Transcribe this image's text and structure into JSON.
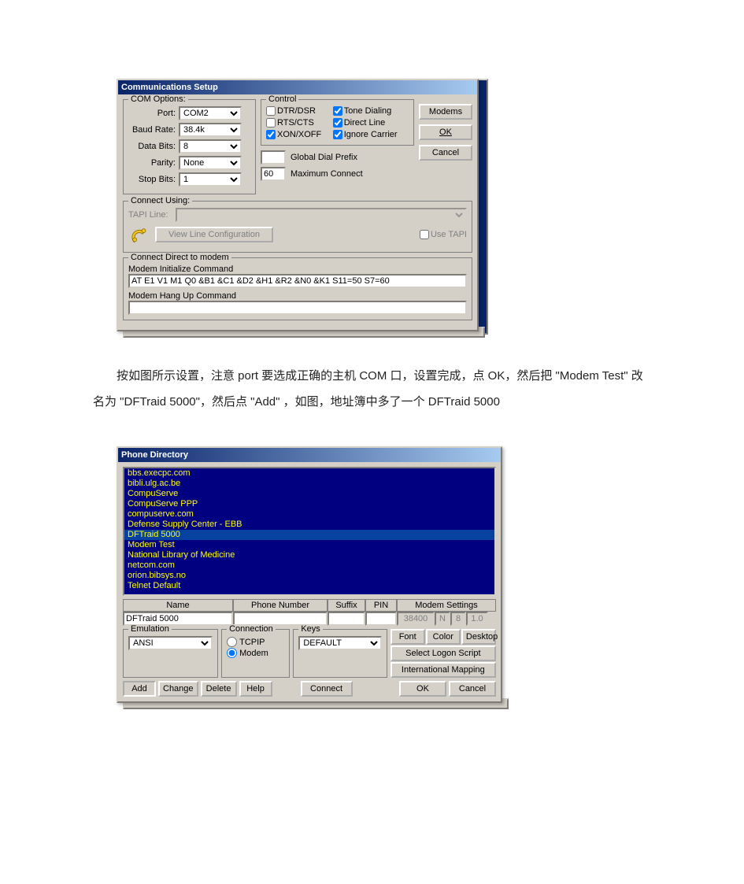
{
  "comm": {
    "title": "Communications Setup",
    "com_options": {
      "legend": "COM Options:",
      "port_label": "Port:",
      "port_value": "COM2",
      "baud_label": "Baud Rate:",
      "baud_value": "38.4k",
      "databits_label": "Data Bits:",
      "databits_value": "8",
      "parity_label": "Parity:",
      "parity_value": "None",
      "stopbits_label": "Stop Bits:",
      "stopbits_value": "1"
    },
    "control": {
      "legend": "Control",
      "dtr": "DTR/DSR",
      "rts": "RTS/CTS",
      "xon": "XON/XOFF",
      "tone": "Tone Dialing",
      "direct": "Direct Line",
      "ignore": "Ignore Carrier",
      "prefix_label": "Global Dial Prefix",
      "prefix_value": "",
      "maxconn_label": "Maximum Connect",
      "maxconn_value": "60"
    },
    "buttons": {
      "modems": "Modems",
      "ok": "OK",
      "cancel": "Cancel"
    },
    "connect_using": {
      "legend": "Connect Using:",
      "tapi_label": "TAPI Line:",
      "view_btn": "View Line Configuration",
      "use_tapi": "Use TAPI"
    },
    "direct_modem": {
      "legend": "Connect Direct to modem",
      "init_label": "Modem Initialize Command",
      "init_value": "AT E1 V1 M1 Q0 &B1 &C1 &D2 &H1 &R2 &N0 &K1 S11=50 S7=60",
      "hangup_label": "Modem Hang Up Command",
      "hangup_value": ""
    }
  },
  "paragraph": "按如图所示设置，注意 port 要选成正确的主机 COM 口，设置完成，点 OK，然后把 \"Modem Test\" 改名为 \"DFTraid 5000\"，然后点 \"Add\" ，如图，地址簿中多了一个 DFTraid 5000",
  "phone": {
    "title": "Phone Directory",
    "items": [
      "bbs.execpc.com",
      "bibli.ulg.ac.be",
      "CompuServe",
      "CompuServe PPP",
      "compuserve.com",
      "Defense Supply Center - EBB",
      "DFTraid 5000",
      "Modem Test",
      "National Library of Medicine",
      "netcom.com",
      "orion.bibsys.no",
      "Telnet Default"
    ],
    "selected_index": 6,
    "headers": {
      "name": "Name",
      "phone": "Phone Number",
      "suffix": "Suffix",
      "pin": "PIN",
      "modemset": "Modem Settings"
    },
    "name_value": "DFTraid 5000",
    "phone_value": "",
    "suffix_value": "",
    "pin_value": "",
    "ro1": "38400",
    "ro2": "N",
    "ro3": "8",
    "ro4": "1.0",
    "emulation": {
      "legend": "Emulation",
      "value": "ANSI"
    },
    "connection": {
      "legend": "Connection",
      "tcpip": "TCPIP",
      "modem": "Modem"
    },
    "keys": {
      "legend": "Keys",
      "value": "DEFAULT"
    },
    "right_buttons": {
      "font": "Font",
      "color": "Color",
      "desktop": "Desktop",
      "script": "Select Logon Script",
      "mapping": "International Mapping"
    },
    "bottom_buttons": {
      "add": "Add",
      "change": "Change",
      "delete": "Delete",
      "help": "Help",
      "connect": "Connect",
      "ok": "OK",
      "cancel": "Cancel"
    }
  }
}
